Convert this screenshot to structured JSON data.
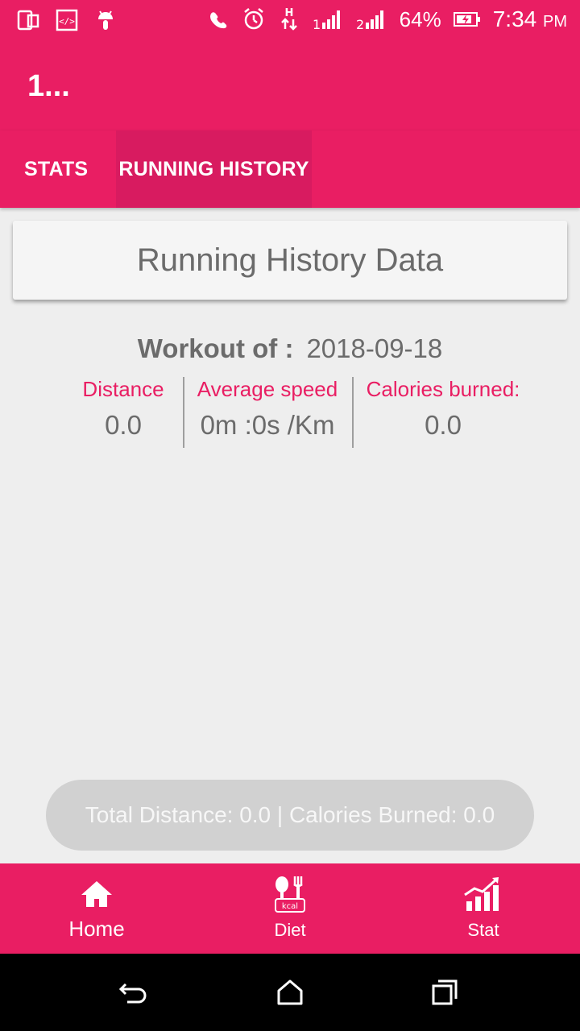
{
  "status_bar": {
    "battery": "64%",
    "time": "7:34",
    "ampm": "PM",
    "icons": [
      "phone-icon",
      "code-icon",
      "android-icon",
      "call-icon",
      "alarm-icon",
      "data-h-icon",
      "signal-1-icon",
      "signal-2-icon",
      "battery-charging-icon"
    ]
  },
  "app_bar": {
    "title": "1..."
  },
  "tabs": [
    {
      "label": "STATS"
    },
    {
      "label": "RUNNING HISTORY",
      "selected": true
    }
  ],
  "card": {
    "title": "Running History Data"
  },
  "workout": {
    "label": "Workout of :",
    "date": "2018-09-18"
  },
  "metrics": [
    {
      "label": "Distance",
      "value": "0.0"
    },
    {
      "label": "Average speed",
      "value": "0m :0s /Km"
    },
    {
      "label": "Calories burned:",
      "value": "0.0"
    }
  ],
  "total_button": {
    "label": "Total Distance: 0.0 | Calories Burned: 0.0"
  },
  "bottom_nav": [
    {
      "label": "Home",
      "icon": "home-icon",
      "active": true
    },
    {
      "label": "Diet",
      "icon": "diet-kcal-icon"
    },
    {
      "label": "Stat",
      "icon": "stat-chart-icon"
    }
  ],
  "colors": {
    "primary": "#e91e63",
    "selected_tab": "#d81b60",
    "accent_text": "#e91e63"
  }
}
